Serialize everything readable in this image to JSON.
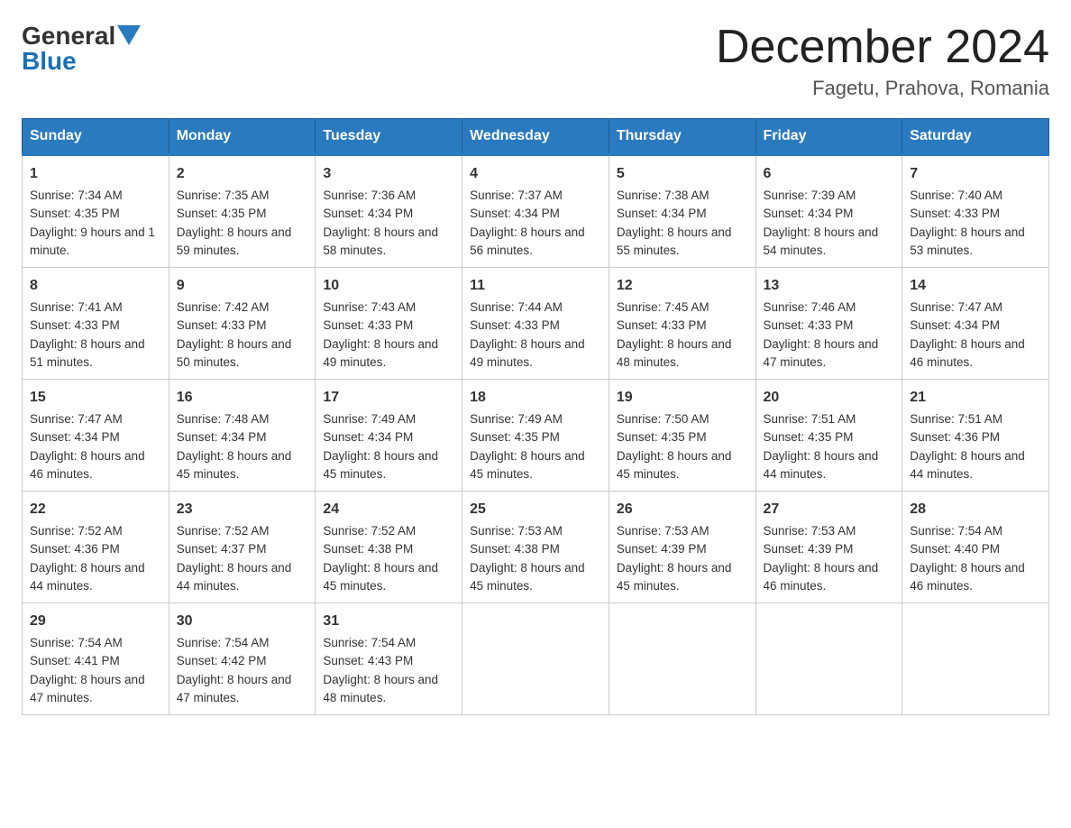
{
  "header": {
    "logo_general": "General",
    "logo_blue": "Blue",
    "month_title": "December 2024",
    "location": "Fagetu, Prahova, Romania"
  },
  "days_of_week": [
    "Sunday",
    "Monday",
    "Tuesday",
    "Wednesday",
    "Thursday",
    "Friday",
    "Saturday"
  ],
  "weeks": [
    [
      {
        "day": "1",
        "sunrise": "Sunrise: 7:34 AM",
        "sunset": "Sunset: 4:35 PM",
        "daylight": "Daylight: 9 hours and 1 minute."
      },
      {
        "day": "2",
        "sunrise": "Sunrise: 7:35 AM",
        "sunset": "Sunset: 4:35 PM",
        "daylight": "Daylight: 8 hours and 59 minutes."
      },
      {
        "day": "3",
        "sunrise": "Sunrise: 7:36 AM",
        "sunset": "Sunset: 4:34 PM",
        "daylight": "Daylight: 8 hours and 58 minutes."
      },
      {
        "day": "4",
        "sunrise": "Sunrise: 7:37 AM",
        "sunset": "Sunset: 4:34 PM",
        "daylight": "Daylight: 8 hours and 56 minutes."
      },
      {
        "day": "5",
        "sunrise": "Sunrise: 7:38 AM",
        "sunset": "Sunset: 4:34 PM",
        "daylight": "Daylight: 8 hours and 55 minutes."
      },
      {
        "day": "6",
        "sunrise": "Sunrise: 7:39 AM",
        "sunset": "Sunset: 4:34 PM",
        "daylight": "Daylight: 8 hours and 54 minutes."
      },
      {
        "day": "7",
        "sunrise": "Sunrise: 7:40 AM",
        "sunset": "Sunset: 4:33 PM",
        "daylight": "Daylight: 8 hours and 53 minutes."
      }
    ],
    [
      {
        "day": "8",
        "sunrise": "Sunrise: 7:41 AM",
        "sunset": "Sunset: 4:33 PM",
        "daylight": "Daylight: 8 hours and 51 minutes."
      },
      {
        "day": "9",
        "sunrise": "Sunrise: 7:42 AM",
        "sunset": "Sunset: 4:33 PM",
        "daylight": "Daylight: 8 hours and 50 minutes."
      },
      {
        "day": "10",
        "sunrise": "Sunrise: 7:43 AM",
        "sunset": "Sunset: 4:33 PM",
        "daylight": "Daylight: 8 hours and 49 minutes."
      },
      {
        "day": "11",
        "sunrise": "Sunrise: 7:44 AM",
        "sunset": "Sunset: 4:33 PM",
        "daylight": "Daylight: 8 hours and 49 minutes."
      },
      {
        "day": "12",
        "sunrise": "Sunrise: 7:45 AM",
        "sunset": "Sunset: 4:33 PM",
        "daylight": "Daylight: 8 hours and 48 minutes."
      },
      {
        "day": "13",
        "sunrise": "Sunrise: 7:46 AM",
        "sunset": "Sunset: 4:33 PM",
        "daylight": "Daylight: 8 hours and 47 minutes."
      },
      {
        "day": "14",
        "sunrise": "Sunrise: 7:47 AM",
        "sunset": "Sunset: 4:34 PM",
        "daylight": "Daylight: 8 hours and 46 minutes."
      }
    ],
    [
      {
        "day": "15",
        "sunrise": "Sunrise: 7:47 AM",
        "sunset": "Sunset: 4:34 PM",
        "daylight": "Daylight: 8 hours and 46 minutes."
      },
      {
        "day": "16",
        "sunrise": "Sunrise: 7:48 AM",
        "sunset": "Sunset: 4:34 PM",
        "daylight": "Daylight: 8 hours and 45 minutes."
      },
      {
        "day": "17",
        "sunrise": "Sunrise: 7:49 AM",
        "sunset": "Sunset: 4:34 PM",
        "daylight": "Daylight: 8 hours and 45 minutes."
      },
      {
        "day": "18",
        "sunrise": "Sunrise: 7:49 AM",
        "sunset": "Sunset: 4:35 PM",
        "daylight": "Daylight: 8 hours and 45 minutes."
      },
      {
        "day": "19",
        "sunrise": "Sunrise: 7:50 AM",
        "sunset": "Sunset: 4:35 PM",
        "daylight": "Daylight: 8 hours and 45 minutes."
      },
      {
        "day": "20",
        "sunrise": "Sunrise: 7:51 AM",
        "sunset": "Sunset: 4:35 PM",
        "daylight": "Daylight: 8 hours and 44 minutes."
      },
      {
        "day": "21",
        "sunrise": "Sunrise: 7:51 AM",
        "sunset": "Sunset: 4:36 PM",
        "daylight": "Daylight: 8 hours and 44 minutes."
      }
    ],
    [
      {
        "day": "22",
        "sunrise": "Sunrise: 7:52 AM",
        "sunset": "Sunset: 4:36 PM",
        "daylight": "Daylight: 8 hours and 44 minutes."
      },
      {
        "day": "23",
        "sunrise": "Sunrise: 7:52 AM",
        "sunset": "Sunset: 4:37 PM",
        "daylight": "Daylight: 8 hours and 44 minutes."
      },
      {
        "day": "24",
        "sunrise": "Sunrise: 7:52 AM",
        "sunset": "Sunset: 4:38 PM",
        "daylight": "Daylight: 8 hours and 45 minutes."
      },
      {
        "day": "25",
        "sunrise": "Sunrise: 7:53 AM",
        "sunset": "Sunset: 4:38 PM",
        "daylight": "Daylight: 8 hours and 45 minutes."
      },
      {
        "day": "26",
        "sunrise": "Sunrise: 7:53 AM",
        "sunset": "Sunset: 4:39 PM",
        "daylight": "Daylight: 8 hours and 45 minutes."
      },
      {
        "day": "27",
        "sunrise": "Sunrise: 7:53 AM",
        "sunset": "Sunset: 4:39 PM",
        "daylight": "Daylight: 8 hours and 46 minutes."
      },
      {
        "day": "28",
        "sunrise": "Sunrise: 7:54 AM",
        "sunset": "Sunset: 4:40 PM",
        "daylight": "Daylight: 8 hours and 46 minutes."
      }
    ],
    [
      {
        "day": "29",
        "sunrise": "Sunrise: 7:54 AM",
        "sunset": "Sunset: 4:41 PM",
        "daylight": "Daylight: 8 hours and 47 minutes."
      },
      {
        "day": "30",
        "sunrise": "Sunrise: 7:54 AM",
        "sunset": "Sunset: 4:42 PM",
        "daylight": "Daylight: 8 hours and 47 minutes."
      },
      {
        "day": "31",
        "sunrise": "Sunrise: 7:54 AM",
        "sunset": "Sunset: 4:43 PM",
        "daylight": "Daylight: 8 hours and 48 minutes."
      },
      null,
      null,
      null,
      null
    ]
  ]
}
